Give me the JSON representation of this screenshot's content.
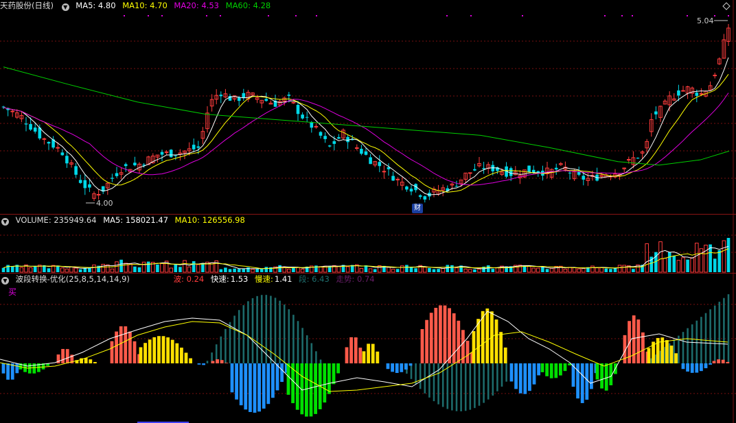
{
  "main": {
    "title": "天药股份(日线)",
    "ma5": "MA5: 4.80",
    "ma10": "MA10: 4.70",
    "ma20": "MA20: 4.53",
    "ma60": "MA60: 4.28",
    "high_label": "5.04",
    "low_label": "4.00",
    "marker_cai": "财",
    "colors": {
      "up": "#ff3c3c",
      "down": "#00d8e8",
      "ma5": "#ffffff",
      "ma10": "#ffff00",
      "ma20": "#e000e0",
      "ma60": "#00d000"
    }
  },
  "volume": {
    "label": "VOLUME: 235949.64",
    "ma5": "MA5: 158021.47",
    "ma10": "MA10: 126556.98"
  },
  "indicator": {
    "name": "波段转换-优化(25,8,5,14,14,9)",
    "bo": "波: 0.24",
    "kuaisu_label": "快速:",
    "kuaisu_value": "1.53",
    "mansu_label": "慢速:",
    "mansu_value": "1.41",
    "duan": "段: 6.43",
    "zoushi": "走势: 0.74",
    "buy": "买"
  }
}
